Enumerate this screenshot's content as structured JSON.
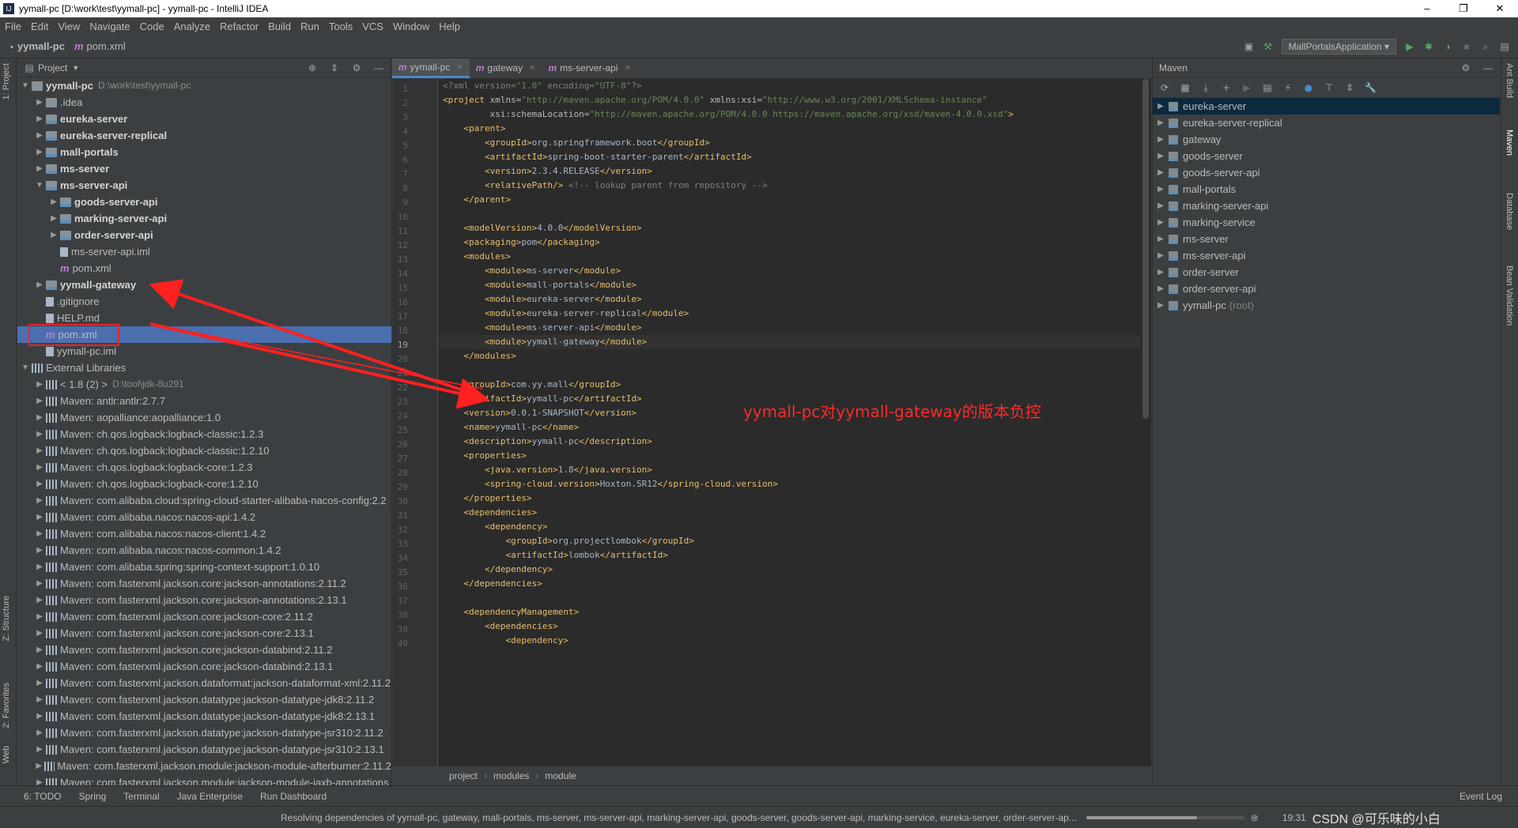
{
  "window": {
    "title": "yymall-pc [D:\\work\\test\\yymall-pc] - yymall-pc - IntelliJ IDEA",
    "minimize": "–",
    "maximize": "❐",
    "close": "✕"
  },
  "menu": [
    "File",
    "Edit",
    "View",
    "Navigate",
    "Code",
    "Analyze",
    "Refactor",
    "Build",
    "Run",
    "Tools",
    "VCS",
    "Window",
    "Help"
  ],
  "navbar": {
    "project": "yymall-pc",
    "file": "pom.xml",
    "run_config": "MallPortalsApplication"
  },
  "left_strip": {
    "project": "1: Project",
    "structure": "Z: Structure",
    "favorites": "2: Favorites",
    "web": "Web"
  },
  "right_strip": {
    "ant": "Ant Build",
    "maven": "Maven",
    "database": "Database",
    "bean": "Bean Validation"
  },
  "project_panel": {
    "title": "Project",
    "tree": [
      {
        "indent": 0,
        "arrow": "▼",
        "icon": "folder",
        "label": "yymall-pc",
        "bold": true,
        "path": "D:\\work\\test\\yymall-pc"
      },
      {
        "indent": 1,
        "arrow": "▶",
        "icon": "folder",
        "label": ".idea"
      },
      {
        "indent": 1,
        "arrow": "▶",
        "icon": "mod-folder",
        "label": "eureka-server",
        "bold": true
      },
      {
        "indent": 1,
        "arrow": "▶",
        "icon": "mod-folder",
        "label": "eureka-server-replical",
        "bold": true
      },
      {
        "indent": 1,
        "arrow": "▶",
        "icon": "mod-folder",
        "label": "mall-portals",
        "bold": true
      },
      {
        "indent": 1,
        "arrow": "▶",
        "icon": "mod-folder",
        "label": "ms-server",
        "bold": true
      },
      {
        "indent": 1,
        "arrow": "▼",
        "icon": "mod-folder",
        "label": "ms-server-api",
        "bold": true
      },
      {
        "indent": 2,
        "arrow": "▶",
        "icon": "mod-folder",
        "label": "goods-server-api",
        "bold": true
      },
      {
        "indent": 2,
        "arrow": "▶",
        "icon": "mod-folder",
        "label": "marking-server-api",
        "bold": true
      },
      {
        "indent": 2,
        "arrow": "▶",
        "icon": "mod-folder",
        "label": "order-server-api",
        "bold": true
      },
      {
        "indent": 2,
        "arrow": "",
        "icon": "file",
        "label": "ms-server-api.iml"
      },
      {
        "indent": 2,
        "arrow": "",
        "icon": "mvn",
        "label": "pom.xml"
      },
      {
        "indent": 1,
        "arrow": "▶",
        "icon": "mod-folder",
        "label": "yymall-gateway",
        "bold": true
      },
      {
        "indent": 1,
        "arrow": "",
        "icon": "file",
        "label": ".gitignore"
      },
      {
        "indent": 1,
        "arrow": "",
        "icon": "file",
        "label": "HELP.md"
      },
      {
        "indent": 1,
        "arrow": "",
        "icon": "mvn",
        "label": "pom.xml",
        "selected": true
      },
      {
        "indent": 1,
        "arrow": "",
        "icon": "file",
        "label": "yymall-pc.iml"
      },
      {
        "indent": 0,
        "arrow": "▼",
        "icon": "lib",
        "label": "External Libraries"
      },
      {
        "indent": 1,
        "arrow": "▶",
        "icon": "lib",
        "label": "< 1.8 (2) >",
        "path": "D:\\tool\\jdk-8u291"
      },
      {
        "indent": 1,
        "arrow": "▶",
        "icon": "lib",
        "label": "Maven: antlr:antlr:2.7.7"
      },
      {
        "indent": 1,
        "arrow": "▶",
        "icon": "lib",
        "label": "Maven: aopalliance:aopalliance:1.0"
      },
      {
        "indent": 1,
        "arrow": "▶",
        "icon": "lib",
        "label": "Maven: ch.qos.logback:logback-classic:1.2.3"
      },
      {
        "indent": 1,
        "arrow": "▶",
        "icon": "lib",
        "label": "Maven: ch.qos.logback:logback-classic:1.2.10"
      },
      {
        "indent": 1,
        "arrow": "▶",
        "icon": "lib",
        "label": "Maven: ch.qos.logback:logback-core:1.2.3"
      },
      {
        "indent": 1,
        "arrow": "▶",
        "icon": "lib",
        "label": "Maven: ch.qos.logback:logback-core:1.2.10"
      },
      {
        "indent": 1,
        "arrow": "▶",
        "icon": "lib",
        "label": "Maven: com.alibaba.cloud:spring-cloud-starter-alibaba-nacos-config:2.2"
      },
      {
        "indent": 1,
        "arrow": "▶",
        "icon": "lib",
        "label": "Maven: com.alibaba.nacos:nacos-api:1.4.2"
      },
      {
        "indent": 1,
        "arrow": "▶",
        "icon": "lib",
        "label": "Maven: com.alibaba.nacos:nacos-client:1.4.2"
      },
      {
        "indent": 1,
        "arrow": "▶",
        "icon": "lib",
        "label": "Maven: com.alibaba.nacos:nacos-common:1.4.2"
      },
      {
        "indent": 1,
        "arrow": "▶",
        "icon": "lib",
        "label": "Maven: com.alibaba.spring:spring-context-support:1.0.10"
      },
      {
        "indent": 1,
        "arrow": "▶",
        "icon": "lib",
        "label": "Maven: com.fasterxml.jackson.core:jackson-annotations:2.11.2"
      },
      {
        "indent": 1,
        "arrow": "▶",
        "icon": "lib",
        "label": "Maven: com.fasterxml.jackson.core:jackson-annotations:2.13.1"
      },
      {
        "indent": 1,
        "arrow": "▶",
        "icon": "lib",
        "label": "Maven: com.fasterxml.jackson.core:jackson-core:2.11.2"
      },
      {
        "indent": 1,
        "arrow": "▶",
        "icon": "lib",
        "label": "Maven: com.fasterxml.jackson.core:jackson-core:2.13.1"
      },
      {
        "indent": 1,
        "arrow": "▶",
        "icon": "lib",
        "label": "Maven: com.fasterxml.jackson.core:jackson-databind:2.11.2"
      },
      {
        "indent": 1,
        "arrow": "▶",
        "icon": "lib",
        "label": "Maven: com.fasterxml.jackson.core:jackson-databind:2.13.1"
      },
      {
        "indent": 1,
        "arrow": "▶",
        "icon": "lib",
        "label": "Maven: com.fasterxml.jackson.dataformat:jackson-dataformat-xml:2.11.2"
      },
      {
        "indent": 1,
        "arrow": "▶",
        "icon": "lib",
        "label": "Maven: com.fasterxml.jackson.datatype:jackson-datatype-jdk8:2.11.2"
      },
      {
        "indent": 1,
        "arrow": "▶",
        "icon": "lib",
        "label": "Maven: com.fasterxml.jackson.datatype:jackson-datatype-jdk8:2.13.1"
      },
      {
        "indent": 1,
        "arrow": "▶",
        "icon": "lib",
        "label": "Maven: com.fasterxml.jackson.datatype:jackson-datatype-jsr310:2.11.2"
      },
      {
        "indent": 1,
        "arrow": "▶",
        "icon": "lib",
        "label": "Maven: com.fasterxml.jackson.datatype:jackson-datatype-jsr310:2.13.1"
      },
      {
        "indent": 1,
        "arrow": "▶",
        "icon": "lib",
        "label": "Maven: com.fasterxml.jackson.module:jackson-module-afterburner:2.11.2"
      },
      {
        "indent": 1,
        "arrow": "▶",
        "icon": "lib",
        "label": "Maven: com.fasterxml.jackson.module:jackson-module-jaxb-annotations"
      }
    ]
  },
  "editor": {
    "tabs": [
      {
        "label": "yymall-pc",
        "active": true
      },
      {
        "label": "gateway",
        "active": false
      },
      {
        "label": "ms-server-api",
        "active": false
      }
    ],
    "current_line": 19,
    "lines": [
      "<span class=\"cm\">&lt;?xml version=</span><span class=\"av\">\"1.0\"</span><span class=\"cm\"> encoding=</span><span class=\"av\">\"UTF-8\"</span><span class=\"cm\">?&gt;</span>",
      "<span class=\"tg\">&lt;project</span> <span class=\"at\">xmlns=</span><span class=\"av\">\"http://maven.apache.org/POM/4.0.0\"</span> <span class=\"at\">xmlns:xsi=</span><span class=\"av\">\"http://www.w3.org/2001/XMLSchema-instance\"</span>",
      "         <span class=\"at\">xsi:schemaLocation=</span><span class=\"av\">\"http://maven.apache.org/POM/4.0.0 https://maven.apache.org/xsd/maven-4.0.0.xsd\"</span><span class=\"tg\">&gt;</span>",
      "    <span class=\"tg\">&lt;parent&gt;</span>",
      "        <span class=\"tg\">&lt;groupId&gt;</span>org.springframework.boot<span class=\"tg\">&lt;/groupId&gt;</span>",
      "        <span class=\"tg\">&lt;artifactId&gt;</span>spring-boot-starter-parent<span class=\"tg\">&lt;/artifactId&gt;</span>",
      "        <span class=\"tg\">&lt;version&gt;</span>2.3.4.RELEASE<span class=\"tg\">&lt;/version&gt;</span>",
      "        <span class=\"tg\">&lt;relativePath/&gt;</span> <span class=\"cm\">&lt;!-- lookup parent from repository --&gt;</span>",
      "    <span class=\"tg\">&lt;/parent&gt;</span>",
      "",
      "    <span class=\"tg\">&lt;modelVersion&gt;</span>4.0.0<span class=\"tg\">&lt;/modelVersion&gt;</span>",
      "    <span class=\"tg\">&lt;packaging&gt;</span>pom<span class=\"tg\">&lt;/packaging&gt;</span>",
      "    <span class=\"tg\">&lt;modules&gt;</span>",
      "        <span class=\"tg\">&lt;module&gt;</span>ms-server<span class=\"tg\">&lt;/module&gt;</span>",
      "        <span class=\"tg\">&lt;module&gt;</span>mall-portals<span class=\"tg\">&lt;/module&gt;</span>",
      "        <span class=\"tg\">&lt;module&gt;</span>eureka-server<span class=\"tg\">&lt;/module&gt;</span>",
      "        <span class=\"tg\">&lt;module&gt;</span>eureka-server-replical<span class=\"tg\">&lt;/module&gt;</span>",
      "        <span class=\"tg\">&lt;module&gt;</span>ms-server-api<span class=\"tg\">&lt;/module&gt;</span>",
      "        <span class=\"tg\">&lt;module&gt;</span>yymall-gateway<span class=\"tg\">&lt;/module&gt;</span>",
      "    <span class=\"tg\">&lt;/modules&gt;</span>",
      "",
      "    <span class=\"tg\">&lt;groupId&gt;</span>com.yy.mall<span class=\"tg\">&lt;/groupId&gt;</span>",
      "    <span class=\"tg\">&lt;artifactId&gt;</span>yymall-pc<span class=\"tg\">&lt;/artifactId&gt;</span>",
      "    <span class=\"tg\">&lt;version&gt;</span>0.0.1-SNAPSHOT<span class=\"tg\">&lt;/version&gt;</span>",
      "    <span class=\"tg\">&lt;name&gt;</span>yymall-pc<span class=\"tg\">&lt;/name&gt;</span>",
      "    <span class=\"tg\">&lt;description&gt;</span>yymall-pc<span class=\"tg\">&lt;/description&gt;</span>",
      "    <span class=\"tg\">&lt;properties&gt;</span>",
      "        <span class=\"tg\">&lt;java.version&gt;</span>1.8<span class=\"tg\">&lt;/java.version&gt;</span>",
      "        <span class=\"tg\">&lt;spring-cloud.version&gt;</span>Hoxton.SR12<span class=\"tg\">&lt;/spring-cloud.version&gt;</span>",
      "    <span class=\"tg\">&lt;/properties&gt;</span>",
      "    <span class=\"tg\">&lt;dependencies&gt;</span>",
      "        <span class=\"tg\">&lt;dependency&gt;</span>",
      "            <span class=\"tg\">&lt;groupId&gt;</span>org.projectlombok<span class=\"tg\">&lt;/groupId&gt;</span>",
      "            <span class=\"tg\">&lt;artifactId&gt;</span>lombok<span class=\"tg\">&lt;/artifactId&gt;</span>",
      "        <span class=\"tg\">&lt;/dependency&gt;</span>",
      "    <span class=\"tg\">&lt;/dependencies&gt;</span>",
      "",
      "    <span class=\"tg\">&lt;dependencyManagement&gt;</span>",
      "        <span class=\"tg\">&lt;dependencies&gt;</span>",
      "            <span class=\"tg\">&lt;dependency&gt;</span>"
    ],
    "breadcrumb": [
      "project",
      "modules",
      "module"
    ]
  },
  "maven_panel": {
    "title": "Maven",
    "items": [
      {
        "label": "eureka-server",
        "selected": true
      },
      {
        "label": "eureka-server-replical"
      },
      {
        "label": "gateway"
      },
      {
        "label": "goods-server"
      },
      {
        "label": "goods-server-api"
      },
      {
        "label": "mall-portals"
      },
      {
        "label": "marking-server-api"
      },
      {
        "label": "marking-service"
      },
      {
        "label": "ms-server"
      },
      {
        "label": "ms-server-api"
      },
      {
        "label": "order-server"
      },
      {
        "label": "order-server-api"
      },
      {
        "label": "yymall-pc",
        "suffix": "(root)"
      }
    ]
  },
  "bottom_tools": {
    "todo": "6: TODO",
    "spring": "Spring",
    "terminal": "Terminal",
    "java_enterprise": "Java Enterprise",
    "run_dashboard": "Run Dashboard",
    "event_log": "Event Log"
  },
  "status": {
    "message": "Resolving dependencies of yymall-pc, gateway, mall-portals, ms-server, ms-server-api, marking-server-api, goods-server, goods-server-api, marking-service, eureka-server, order-server-ap...",
    "progress": 0.7,
    "time": "19:31",
    "watermark": "CSDN @可乐味的小白"
  },
  "annotation": {
    "text": "yymall-pc对yymall-gateway的版本负控",
    "color": "#ff2a2a"
  },
  "colors": {
    "accent": "#4a88c7",
    "selection": "#4b6eaf",
    "annotation_red": "#ff2020"
  }
}
